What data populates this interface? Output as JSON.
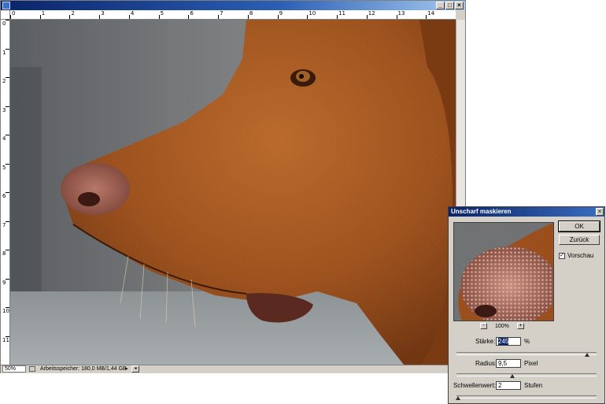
{
  "ruler": {
    "h_labels": [
      "0",
      "1",
      "2",
      "3",
      "4",
      "5",
      "6",
      "7",
      "8",
      "9",
      "10",
      "11",
      "12",
      "13",
      "14"
    ],
    "v_labels": [
      "0",
      "1",
      "2",
      "3",
      "4",
      "5",
      "6",
      "7",
      "8",
      "9",
      "10",
      "11"
    ]
  },
  "status": {
    "zoom": "50%",
    "memory": "Arbeitsspeicher: 180,0 MB/1,44 GB"
  },
  "window_buttons": {
    "minimize": "_",
    "maximize": "□",
    "close": "×"
  },
  "dialog": {
    "title": "Unscharf maskieren",
    "close": "×",
    "ok_label": "OK",
    "cancel_label": "Zurück",
    "preview_label": "Vorschau",
    "preview_checked": true,
    "zoom_out": "-",
    "zoom_in": "+",
    "zoom_level": "100%",
    "amount": {
      "label": "Stärke:",
      "value": "245",
      "unit": "%",
      "fraction": 0.93
    },
    "radius": {
      "label": "Radius:",
      "value": "9,5",
      "unit": "Pixel",
      "fraction": 0.4
    },
    "threshold": {
      "label": "Schwellenwert:",
      "value": "2",
      "unit": "Stufen",
      "fraction": 0.01
    }
  },
  "colors": {
    "titlebar": "#0a246a",
    "dog_fur": "#a0521e",
    "background": "#6e6e6e"
  }
}
